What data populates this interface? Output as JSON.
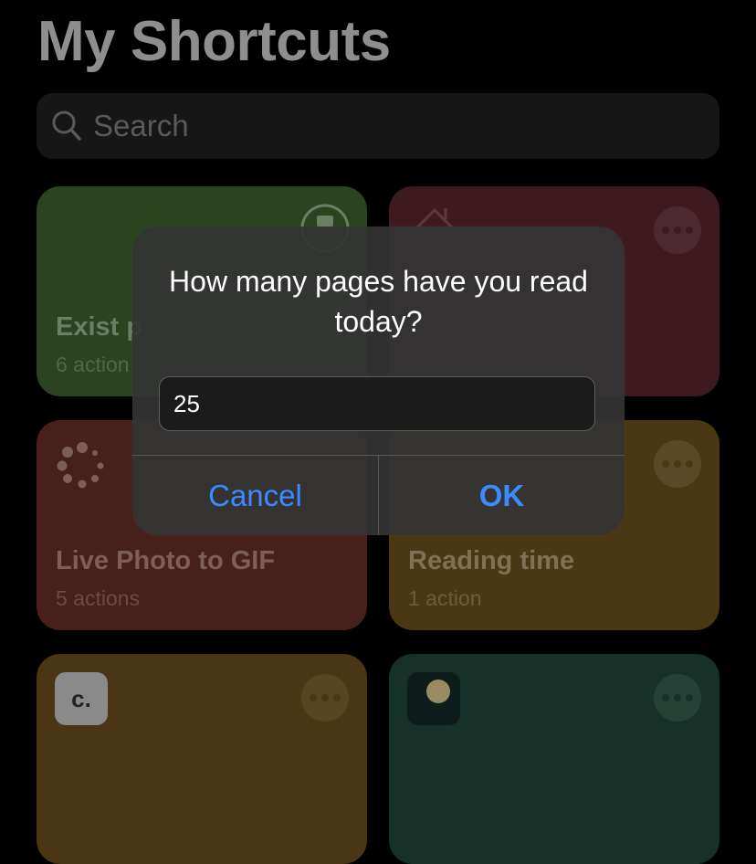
{
  "header": {
    "title": "My Shortcuts"
  },
  "search": {
    "placeholder": "Search",
    "icon": "search-icon"
  },
  "shortcuts": [
    {
      "name": "Exist p",
      "actions": "6 action",
      "color": "#2a441f"
    },
    {
      "name": "",
      "actions": "",
      "color": "#3c1a20"
    },
    {
      "name": "Live Photo to GIF",
      "actions": "5 actions",
      "color": "#48201b"
    },
    {
      "name": "Reading time",
      "actions": "1 action",
      "color": "#4a3814"
    },
    {
      "name": "",
      "actions": "",
      "color": "#4a3514",
      "icon_text": "c."
    },
    {
      "name": "",
      "actions": "",
      "color": "#163228"
    }
  ],
  "alert": {
    "message": "How many pages have you read today?",
    "input_value": "25",
    "cancel_label": "Cancel",
    "ok_label": "OK",
    "button_color": "#3c8aff"
  }
}
